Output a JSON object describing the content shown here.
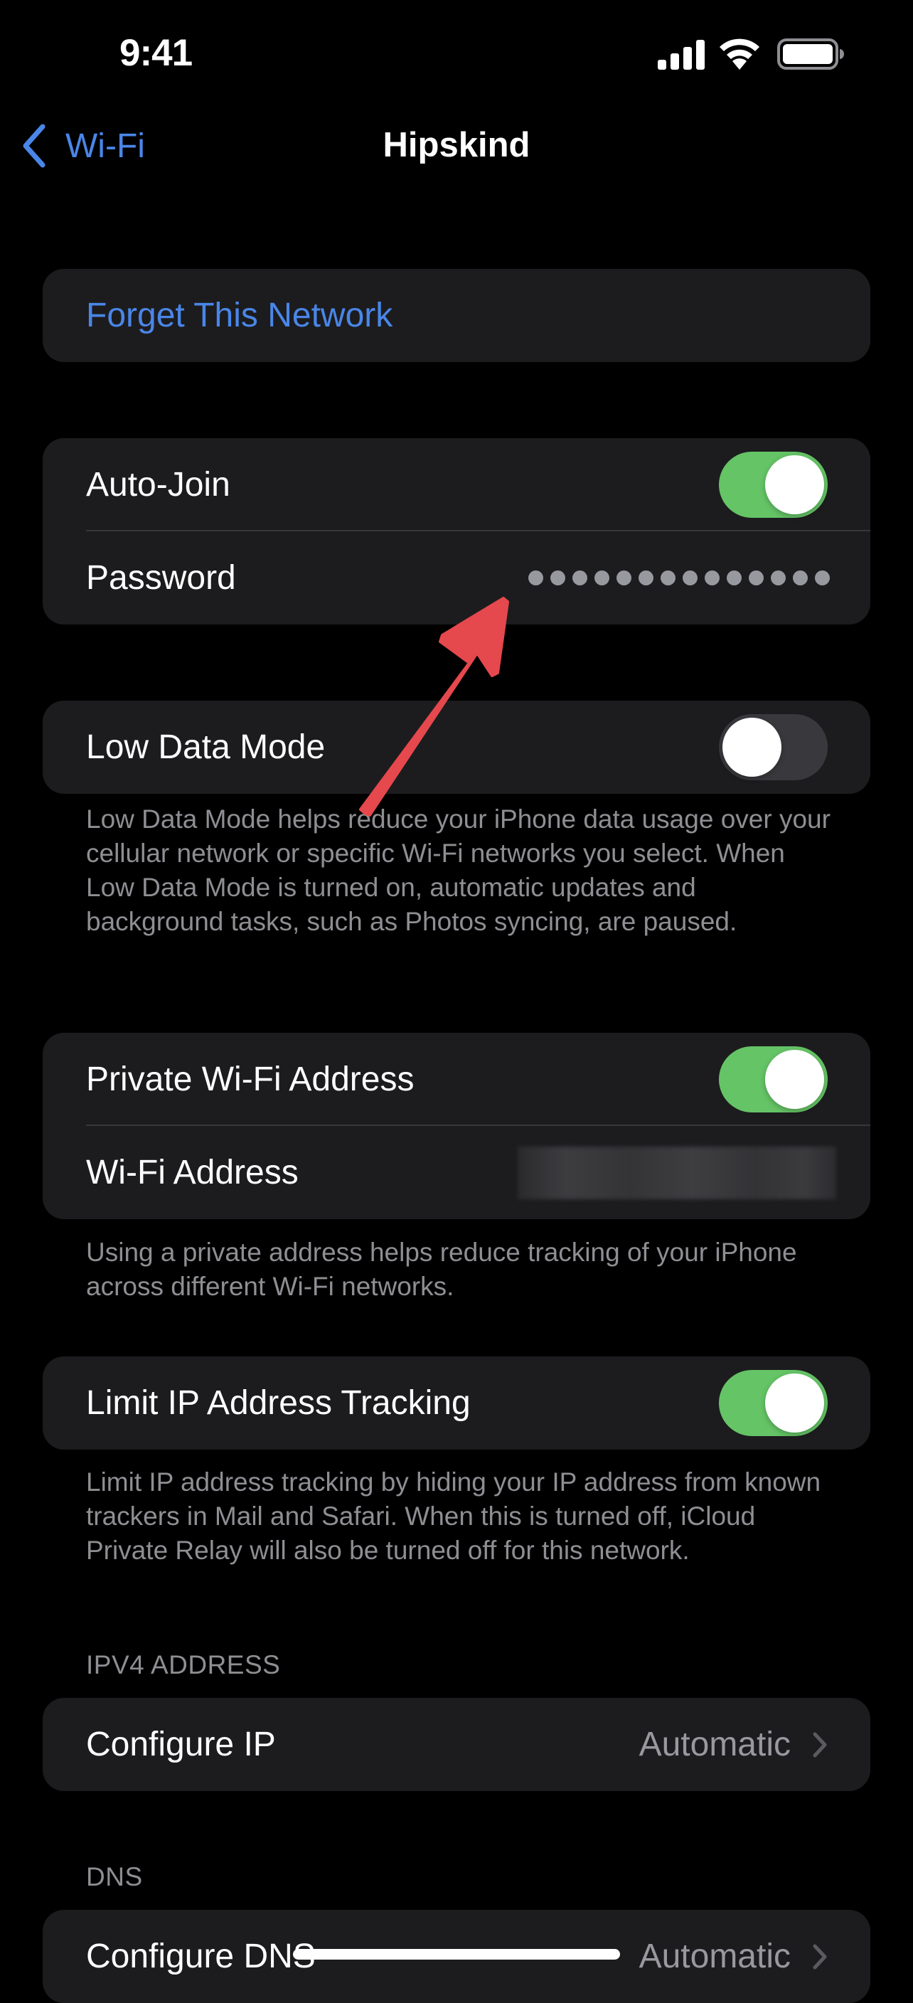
{
  "status_bar": {
    "time": "9:41",
    "icons": [
      "cellular-signal-icon",
      "wifi-icon",
      "battery-icon"
    ]
  },
  "nav": {
    "back_label": "Wi-Fi",
    "back_icon": "chevron-left-icon",
    "title": "Hipskind"
  },
  "colors": {
    "accent_blue": "#4a86e8",
    "toggle_on": "#65c466",
    "toggle_off": "#39393d",
    "card_bg": "#1c1c1e",
    "secondary_text": "#8e8e93",
    "annotation_arrow": "#e5484d"
  },
  "forget": {
    "label": "Forget This Network"
  },
  "join_group": {
    "auto_join": {
      "label": "Auto-Join",
      "on": true
    },
    "password": {
      "label": "Password",
      "masked_length": 14
    }
  },
  "low_data": {
    "label": "Low Data Mode",
    "on": false,
    "footer": "Low Data Mode helps reduce your iPhone data usage over your cellular network or specific Wi-Fi networks you select. When Low Data Mode is turned on, automatic updates and background tasks, such as Photos syncing, are paused."
  },
  "private_group": {
    "private_address": {
      "label": "Private Wi-Fi Address",
      "on": true
    },
    "wifi_address": {
      "label": "Wi-Fi Address",
      "value_state": "blurred"
    },
    "footer": "Using a private address helps reduce tracking of your iPhone across different Wi-Fi networks."
  },
  "limit_ip": {
    "label": "Limit IP Address Tracking",
    "on": true,
    "footer": "Limit IP address tracking by hiding your IP address from known trackers in Mail and Safari. When this is turned off, iCloud Private Relay will also be turned off for this network."
  },
  "ipv4": {
    "header": "IPV4 ADDRESS",
    "configure_ip": {
      "label": "Configure IP",
      "value": "Automatic"
    }
  },
  "dns": {
    "header": "DNS",
    "configure_dns": {
      "label": "Configure DNS",
      "value": "Automatic"
    }
  },
  "annotation": {
    "type": "arrow",
    "points_to": "password-dots"
  }
}
